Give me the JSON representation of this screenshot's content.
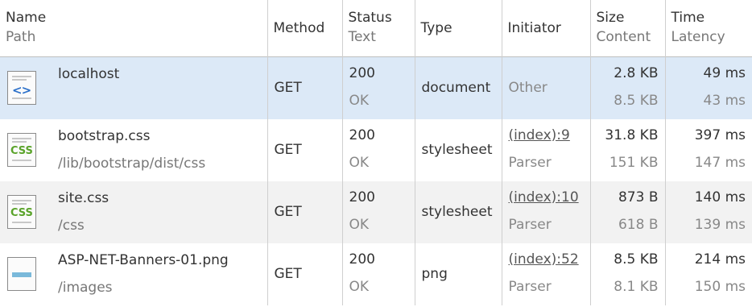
{
  "columns": [
    {
      "line1": "Name",
      "line2": "Path"
    },
    {
      "line1": "Method"
    },
    {
      "line1": "Status",
      "line2": "Text"
    },
    {
      "line1": "Type"
    },
    {
      "line1": "Initiator"
    },
    {
      "line1": "Size",
      "line2": "Content"
    },
    {
      "line1": "Time",
      "line2": "Latency"
    }
  ],
  "rows": [
    {
      "icon": "html-document-icon",
      "icon_text": "<>",
      "name": "localhost",
      "path": "",
      "method": "GET",
      "status": "200",
      "status_text": "OK",
      "type": "document",
      "initiator": "",
      "initiator_type": "Other",
      "size": "2.8 KB",
      "content": "8.5 KB",
      "time": "49 ms",
      "latency": "43 ms"
    },
    {
      "icon": "css-file-icon",
      "icon_text": "CSS",
      "name": "bootstrap.css",
      "path": "/lib/bootstrap/dist/css",
      "method": "GET",
      "status": "200",
      "status_text": "OK",
      "type": "stylesheet",
      "initiator": "(index):9",
      "initiator_type": "Parser",
      "size": "31.8 KB",
      "content": "151 KB",
      "time": "397 ms",
      "latency": "147 ms"
    },
    {
      "icon": "css-file-icon",
      "icon_text": "CSS",
      "name": "site.css",
      "path": "/css",
      "method": "GET",
      "status": "200",
      "status_text": "OK",
      "type": "stylesheet",
      "initiator": "(index):10",
      "initiator_type": "Parser",
      "size": "873 B",
      "content": "618 B",
      "time": "140 ms",
      "latency": "139 ms"
    },
    {
      "icon": "image-file-icon",
      "icon_text": "",
      "name": "ASP-NET-Banners-01.png",
      "path": "/images",
      "method": "GET",
      "status": "200",
      "status_text": "OK",
      "type": "png",
      "initiator": "(index):52",
      "initiator_type": "Parser",
      "size": "8.5 KB",
      "content": "8.1 KB",
      "time": "214 ms",
      "latency": "150 ms"
    }
  ]
}
